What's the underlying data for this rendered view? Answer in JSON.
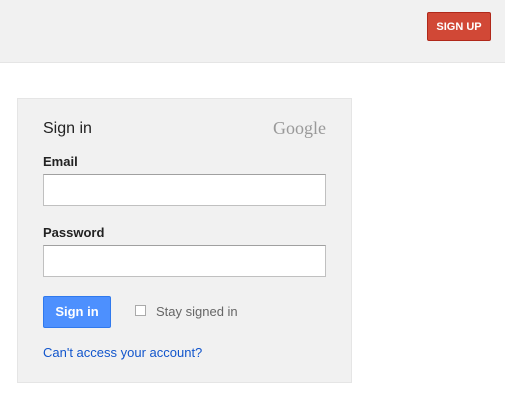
{
  "header": {
    "signup_label": "SIGN UP"
  },
  "signin_card": {
    "title": "Sign in",
    "brand": "Google",
    "email_label": "Email",
    "email_value": "",
    "password_label": "Password",
    "password_value": "",
    "signin_label": "Sign in",
    "stay_signed_in_label": "Stay signed in",
    "stay_signed_in_checked": false,
    "help_link": "Can't access your account?"
  },
  "colors": {
    "signup_button": "#d14836",
    "signin_button": "#4d90fe",
    "link": "#1155cc",
    "card_background": "#f1f1f1"
  }
}
